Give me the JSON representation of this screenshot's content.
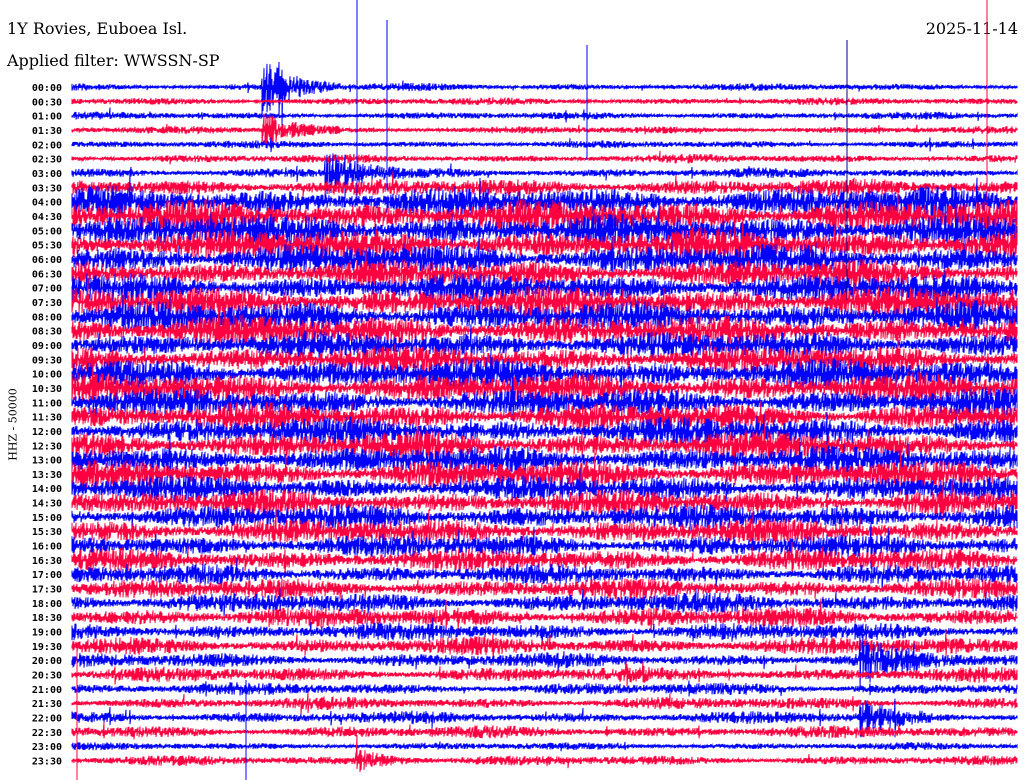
{
  "header": {
    "station": "1Y Rovies, Euboea Isl.",
    "filter": "Applied filter: WWSSN-SP",
    "date": "2025-11-14"
  },
  "chart_data": {
    "type": "line",
    "title": "1Y Rovies, Euboea Isl.",
    "ylabel": "HHZ - 50000",
    "xlabel": "",
    "minutes_per_line": 30,
    "colors": [
      "#0000ff",
      "#ff0040"
    ],
    "rows": [
      "00:00",
      "00:30",
      "01:00",
      "01:30",
      "02:00",
      "02:30",
      "03:00",
      "03:30",
      "04:00",
      "04:30",
      "05:00",
      "05:30",
      "06:00",
      "06:30",
      "07:00",
      "07:30",
      "08:00",
      "08:30",
      "09:00",
      "09:30",
      "10:00",
      "10:30",
      "11:00",
      "11:30",
      "12:00",
      "12:30",
      "13:00",
      "13:30",
      "14:00",
      "14:30",
      "15:00",
      "15:30",
      "16:00",
      "16:30",
      "17:00",
      "17:30",
      "18:00",
      "18:30",
      "19:00",
      "19:30",
      "20:00",
      "20:30",
      "21:00",
      "21:30",
      "22:00",
      "22:30",
      "23:00",
      "23:30"
    ],
    "relative_amplitude": [
      3,
      3,
      3,
      3,
      3,
      3.5,
      4,
      7,
      12,
      13,
      13,
      13,
      12,
      11,
      11,
      12,
      12,
      12,
      11,
      11,
      12,
      12,
      11,
      11,
      11,
      11,
      11,
      11,
      10,
      10,
      10,
      10,
      9,
      9,
      8,
      8,
      8,
      8,
      7,
      7,
      6,
      6,
      5,
      5,
      5,
      5,
      3,
      4
    ],
    "events": [
      {
        "row": 0,
        "minute": 6,
        "amp": 30
      },
      {
        "row": 3,
        "minute": 6,
        "amp": 18
      },
      {
        "row": 6,
        "minute": 8,
        "amp": 25
      },
      {
        "row": 40,
        "minute": 25,
        "amp": 22
      },
      {
        "row": 44,
        "minute": 25,
        "amp": 16
      },
      {
        "row": 47,
        "minute": 9,
        "amp": 10
      }
    ]
  }
}
